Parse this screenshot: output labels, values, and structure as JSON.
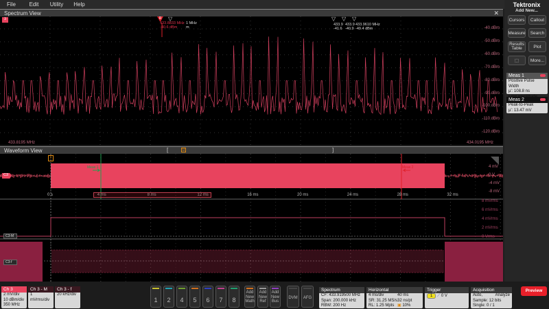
{
  "menu": [
    "File",
    "Edit",
    "Utility",
    "Help"
  ],
  "spectrum": {
    "title": "Spectrum View",
    "y_ticks": [
      "-40 dBm",
      "-50 dBm",
      "-60 dBm",
      "-70 dBm",
      "-80 dBm",
      "-90 dBm",
      "-100 dBm",
      "-110 dBm",
      "-120 dBm"
    ],
    "start_freq": "433.8195 MHz",
    "stop_freq": "434.0195 MHz",
    "marker_ref": {
      "label": "R",
      "freq": "433.8833 MHz",
      "level": "-40.6 dBm",
      "extra1": "1 MHz",
      "extra2": "m"
    },
    "markers": [
      {
        "freq": "433.9",
        "level": "-41.6"
      },
      {
        "freq": "433.9",
        "level": "-40.9"
      },
      {
        "freq": "433.9610 MHz",
        "level": "-49.4 dBm"
      }
    ],
    "trace_color": "#d4405f"
  },
  "waveform": {
    "title": "Waveform View",
    "ch_label": "C3",
    "m_label": "C3-M",
    "f_label": "C3-f",
    "trigger_label": "T",
    "meas1_label": "Meas 1",
    "meas2_label": "Meas 2",
    "y_ticks": [
      "4 mV",
      "0 V",
      "-4 mV",
      "-8 mV"
    ],
    "m_ticks": [
      "8 mVrms",
      "6 mVrms",
      "4 mVrms",
      "2 mVrms",
      "0 Vrms"
    ],
    "time_ticks": [
      "0 s",
      "4 ms",
      "8 ms",
      "12 ms",
      "16 ms",
      "20 ms",
      "24 ms",
      "28 ms",
      "32 ms"
    ],
    "colors": {
      "ch3": "#e8435e",
      "meas1": "#1fa050",
      "meas2": "#e0202a",
      "trigger": "#e08a10"
    }
  },
  "sidebar": {
    "brand": "Tektronix",
    "add_new": "Add New...",
    "buttons": [
      "Cursors",
      "Callout",
      "Measure",
      "Search",
      "Results Table",
      "Plot",
      "More..."
    ],
    "meas": [
      {
        "title": "Meas 1",
        "line1": "Positive Pulse Width",
        "line2": "µ': 108.8 ns",
        "line3": "Low amplitude"
      },
      {
        "title": "Meas 2",
        "line1": "Peak-to-Peak",
        "line2": "µ': 13.47 mV"
      }
    ]
  },
  "bottom": {
    "ch3": {
      "title": "Ch 3",
      "l1": "2 mV/div",
      "l2": "10 dBm/div",
      "l3": "350 MHz"
    },
    "ch3m": {
      "title": "Ch 3 - M",
      "l1": "1 mVrms/div"
    },
    "ch3f": {
      "title": "Ch 3 - f",
      "l1": "20 kHz/div"
    },
    "channels": [
      {
        "n": "1",
        "c": "#c8c030"
      },
      {
        "n": "2",
        "c": "#20a0b0"
      },
      {
        "n": "4",
        "c": "#70a030"
      },
      {
        "n": "5",
        "c": "#d07020"
      },
      {
        "n": "6",
        "c": "#3040c0"
      },
      {
        "n": "7",
        "c": "#c04090"
      },
      {
        "n": "8",
        "c": "#20a070"
      }
    ],
    "add_math": "Add New Math",
    "add_ref": "Add New Ref",
    "add_bus": "Add New Bus",
    "dvm": "DVM",
    "afg": "AFG",
    "spectrum": {
      "title": "Spectrum",
      "cf": "CF: 433.919500 MHz",
      "span": "Span: 200.000 kHz",
      "rbw": "RBW: 200 Hz"
    },
    "horizontal": {
      "title": "Horizontal",
      "a": "4 ms/div",
      "b": "40 ms",
      "c": "SR: 31.25 MS/s",
      "d": "32 ns/pt",
      "e": "RL: 1.25 Mpts",
      "f": "10%"
    },
    "trigger": {
      "title": "Trigger",
      "src": "1",
      "level": "0 V"
    },
    "acquisition": {
      "title": "Acquisition",
      "a": "Auto,",
      "b": "Analyze",
      "c": "Sample: 12 bits",
      "d": "Single: 0 / 1"
    },
    "preview": "Preview"
  }
}
